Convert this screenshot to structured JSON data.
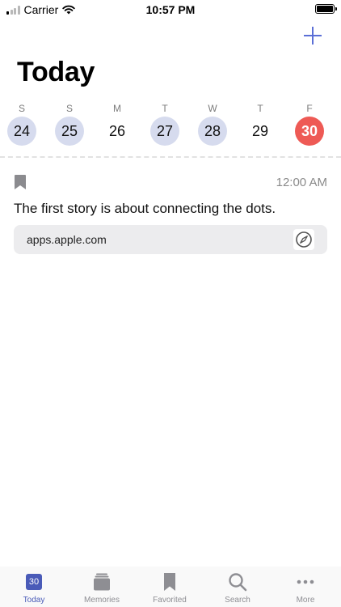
{
  "status_bar": {
    "carrier": "Carrier",
    "time": "10:57 PM"
  },
  "header": {
    "title": "Today"
  },
  "week": {
    "days": [
      {
        "letter": "S",
        "number": "24",
        "state": "has-entry"
      },
      {
        "letter": "S",
        "number": "25",
        "state": "has-entry"
      },
      {
        "letter": "M",
        "number": "26",
        "state": "none"
      },
      {
        "letter": "T",
        "number": "27",
        "state": "has-entry"
      },
      {
        "letter": "W",
        "number": "28",
        "state": "has-entry"
      },
      {
        "letter": "T",
        "number": "29",
        "state": "none"
      },
      {
        "letter": "F",
        "number": "30",
        "state": "today"
      }
    ]
  },
  "entry": {
    "time": "12:00 AM",
    "text": "The first story is about connecting the dots.",
    "link": "apps.apple.com"
  },
  "tab_bar": {
    "today_icon_number": "30",
    "tabs": [
      {
        "label": "Today"
      },
      {
        "label": "Memories"
      },
      {
        "label": "Favorited"
      },
      {
        "label": "Search"
      },
      {
        "label": "More"
      }
    ]
  },
  "colors": {
    "accent": "#4a5bb8",
    "today": "#ee5a55",
    "entry_day": "#d6dbee",
    "plus": "#5b6fd6"
  }
}
